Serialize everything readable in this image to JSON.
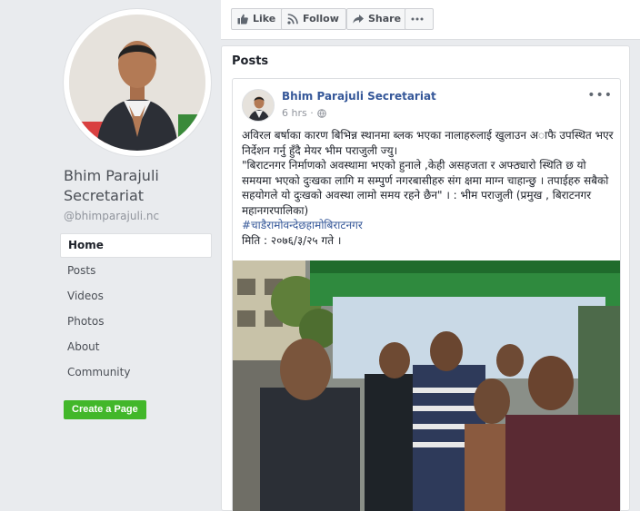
{
  "page": {
    "name": "Bhim Parajuli Secretariat",
    "handle": "@bhimparajuli.nc"
  },
  "nav": {
    "items": [
      {
        "label": "Home"
      },
      {
        "label": "Posts"
      },
      {
        "label": "Videos"
      },
      {
        "label": "Photos"
      },
      {
        "label": "About"
      },
      {
        "label": "Community"
      }
    ],
    "active_index": 0
  },
  "create_page_label": "Create a Page",
  "actions": {
    "like": "Like",
    "follow": "Follow",
    "share": "Share"
  },
  "posts_section": {
    "title": "Posts"
  },
  "post": {
    "author": "Bhim Parajuli Secretariat",
    "time": "6 hrs ·",
    "text_lines": [
      "अविरल बर्षाका कारण बिभिन्न स्थानमा ब्लक भएका नालाहरुलाई खुलाउन अाफै उपस्थित भएर निर्देशन गर्नु हुँदै मेयर भीम पराजुली ज्यु।",
      "\"बिराटनगर निर्माणको अवस्थामा भएको हुनाले ,केही असहजता र अफ्ठ्यारो स्थिति छ यो समयमा भएको दुःखका लागि म सम्पुर्ण नगरबासीहरु संग क्षमा माग्न चाहान्छु । तपाईहरु सबैको सहयोगले यो दुःखको अवस्था लामो समय रहने छैन\" । : भीम पराजुली (प्रमुख , बिराटनगर महानगरपालिका)"
    ],
    "hashtag": "#चाडैरामोवन्देछहामोबिराटनगर",
    "date_line": "मिति : २०७६/३/२५ गते ।"
  },
  "colors": {
    "link": "#365899",
    "create_button": "#42b72a",
    "background": "#e9ebee"
  },
  "icons": {
    "like": "thumbs-up-icon",
    "follow": "rss-icon",
    "share": "share-arrow-icon",
    "more": "more-dots-icon",
    "audience": "globe-icon"
  }
}
